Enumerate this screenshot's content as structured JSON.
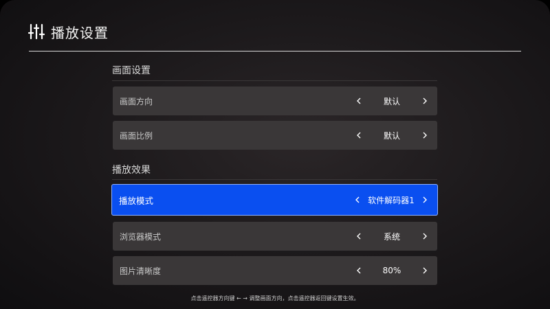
{
  "header": {
    "icon": "sliders-icon",
    "title": "播放设置"
  },
  "sections": [
    {
      "title": "画面设置",
      "rows": [
        {
          "label": "画面方向",
          "value": "默认",
          "active": false
        },
        {
          "label": "画面比例",
          "value": "默认",
          "active": false
        }
      ]
    },
    {
      "title": "播放效果",
      "rows": [
        {
          "label": "播放模式",
          "value": "软件解码器1",
          "active": true
        },
        {
          "label": "浏览器模式",
          "value": "系统",
          "active": false
        },
        {
          "label": "图片清晰度",
          "value": "80%",
          "active": false
        }
      ]
    }
  ],
  "hint": "点击遥控器方向键 ← → 调整画面方向，点击遥控器返回键设置生效。",
  "colors": {
    "active_row": "#0a4ff0",
    "row_bg": "#3a3738",
    "background": "#1d1a1c"
  }
}
